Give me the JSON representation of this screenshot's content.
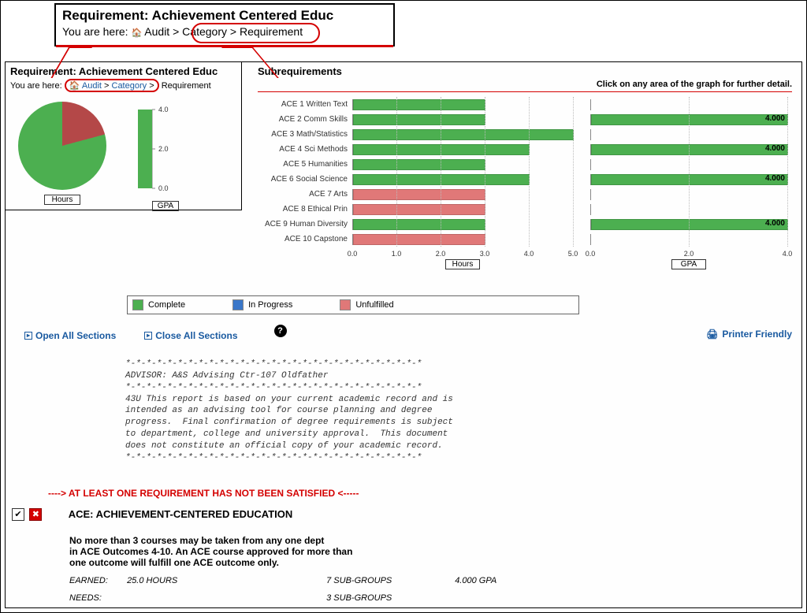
{
  "zoom_breadcrumb": {
    "title": "Requirement: Achievement Centered Educ",
    "prefix": "You are here:",
    "audit": "Audit",
    "category": "Category",
    "requirement": "Requirement"
  },
  "panel_breadcrumb": {
    "title": "Requirement: Achievement Centered Educ",
    "prefix": "You are here:",
    "audit": "Audit",
    "category": "Category",
    "requirement": "Requirement"
  },
  "labels": {
    "hours": "Hours",
    "gpa": "GPA",
    "subreq_title": "Subrequirements",
    "subreq_hint": "Click on any area of the graph for further detail.",
    "legend_complete": "Complete",
    "legend_inprogress": "In Progress",
    "legend_unfulfilled": "Unfulfilled",
    "open_all": "Open All Sections",
    "close_all": "Close All Sections",
    "printer": "Printer Friendly"
  },
  "advisory": "*-*-*-*-*-*-*-*-*-*-*-*-*-*-*-*-*-*-*-*-*-*-*-*-*-*-*-*-*\nADVISOR: A&S Advising Ctr-107 Oldfather\n*-*-*-*-*-*-*-*-*-*-*-*-*-*-*-*-*-*-*-*-*-*-*-*-*-*-*-*-*\n43U This report is based on your current academic record and is\nintended as an advising tool for course planning and degree\nprogress.  Final confirmation of degree requirements is subject\nto department, college and university approval.  This document\ndoes not constitute an official copy of your academic record.\n*-*-*-*-*-*-*-*-*-*-*-*-*-*-*-*-*-*-*-*-*-*-*-*-*-*-*-*-*",
  "warning": "----> AT LEAST ONE REQUIREMENT HAS NOT BEEN SATISFIED <-----",
  "section": {
    "title": "ACE: ACHIEVEMENT-CENTERED EDUCATION",
    "body1": "No more than 3 courses may be taken from any one dept",
    "body2": "in ACE Outcomes 4-10. An ACE course approved for more than",
    "body3": "one outcome will fulfill one ACE outcome only.",
    "earned_label": "EARNED:",
    "earned_hours": "25.0  HOURS",
    "earned_sub": "7  SUB-GROUPS",
    "earned_gpa": "4.000  GPA",
    "needs_label": "NEEDS:",
    "needs_sub": "3  SUB-GROUPS"
  },
  "chart_data": [
    {
      "type": "pie",
      "title": "Hours",
      "series": [
        {
          "name": "Complete",
          "value": 79,
          "color": "#4caf50"
        },
        {
          "name": "Unfulfilled",
          "value": 21,
          "color": "#b44848"
        }
      ]
    },
    {
      "type": "bar",
      "title": "GPA",
      "orientation": "vertical",
      "ylim": [
        0,
        4
      ],
      "ticks": [
        0.0,
        2.0,
        4.0
      ],
      "values": [
        4.0
      ],
      "colors": [
        "#4caf50"
      ]
    },
    {
      "type": "bar",
      "title": "Hours",
      "orientation": "horizontal",
      "xlabel": "Hours",
      "xlim": [
        0,
        5
      ],
      "ticks": [
        0.0,
        1.0,
        2.0,
        3.0,
        4.0,
        5.0
      ],
      "categories": [
        "ACE 1 Written Text",
        "ACE 2 Comm Skills",
        "ACE 3 Math/Statistics",
        "ACE 4 Sci Methods",
        "ACE 5 Humanities",
        "ACE 6 Social Science",
        "ACE 7 Arts",
        "ACE 8 Ethical Prin",
        "ACE 9 Human Diversity",
        "ACE 10 Capstone"
      ],
      "series": [
        {
          "name": "value",
          "values": [
            3,
            3,
            5,
            4,
            3,
            4,
            3,
            3,
            3,
            3
          ]
        },
        {
          "name": "status",
          "values": [
            "Complete",
            "Complete",
            "Complete",
            "Complete",
            "Complete",
            "Complete",
            "Unfulfilled",
            "Unfulfilled",
            "Complete",
            "Unfulfilled"
          ]
        }
      ]
    },
    {
      "type": "bar",
      "title": "GPA",
      "orientation": "horizontal",
      "xlabel": "GPA",
      "xlim": [
        0,
        4
      ],
      "ticks": [
        0.0,
        2.0,
        4.0
      ],
      "categories": [
        "ACE 1 Written Text",
        "ACE 2 Comm Skills",
        "ACE 3 Math/Statistics",
        "ACE 4 Sci Methods",
        "ACE 5 Humanities",
        "ACE 6 Social Science",
        "ACE 7 Arts",
        "ACE 8 Ethical Prin",
        "ACE 9 Human Diversity",
        "ACE 10 Capstone"
      ],
      "series": [
        {
          "name": "gpa",
          "values": [
            null,
            4.0,
            null,
            4.0,
            null,
            4.0,
            null,
            null,
            4.0,
            null
          ]
        }
      ]
    }
  ]
}
